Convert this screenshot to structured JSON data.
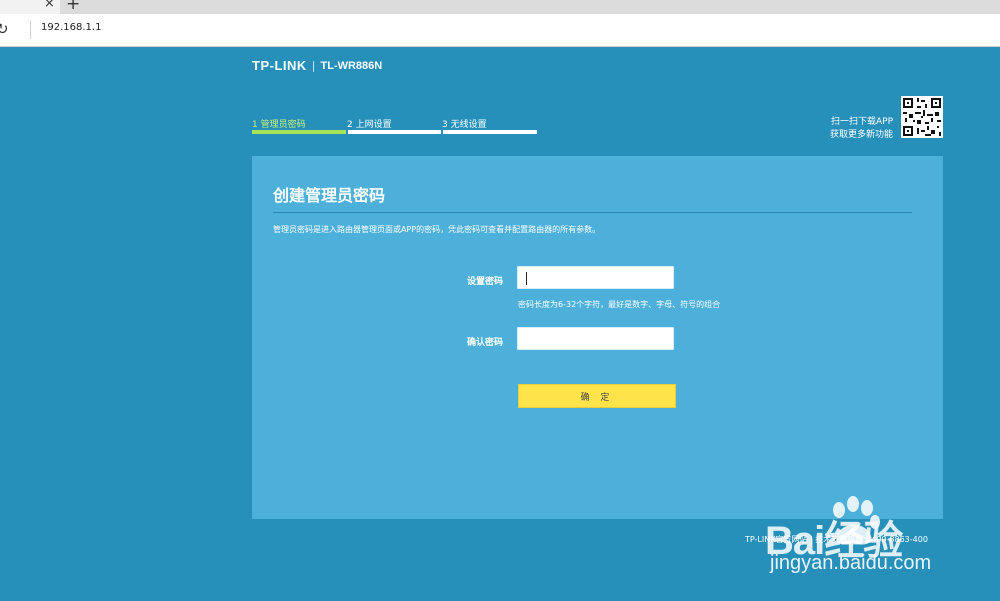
{
  "browser": {
    "close_glyph": "×",
    "new_tab_glyph": "+",
    "reload_glyph": "↻",
    "url": "192.168.1.1"
  },
  "header": {
    "brand": "TP-LINK",
    "separator": "|",
    "model": "TL-WR886N"
  },
  "steps": [
    {
      "label": "1 管理员密码",
      "active": true
    },
    {
      "label": "2 上网设置",
      "active": false
    },
    {
      "label": "3 无线设置",
      "active": false
    }
  ],
  "promo": {
    "line1": "扫一扫下载APP",
    "line2": "获取更多新功能"
  },
  "form": {
    "title": "创建管理员密码",
    "description": "管理员密码是进入路由器管理页面或APP的密码，凭此密码可查看并配置路由器的所有参数。",
    "password_label": "设置密码",
    "password_value": "",
    "password_hint": "密码长度为6-32个字符，最好是数字、字母、符号的组合",
    "confirm_label": "确认密码",
    "confirm_value": "",
    "submit_label": "确 定"
  },
  "footer": {
    "text": "TP-LINK官方网站 | 技术支持热线：400-8863-400"
  },
  "watermark": {
    "brand": "Bai经验",
    "url": "jingyan.baidu.com"
  },
  "colors": {
    "page_bg": "#2690bb",
    "panel_bg": "#4cb0da",
    "active_step": "#a8e45a",
    "button": "#fee44a"
  }
}
